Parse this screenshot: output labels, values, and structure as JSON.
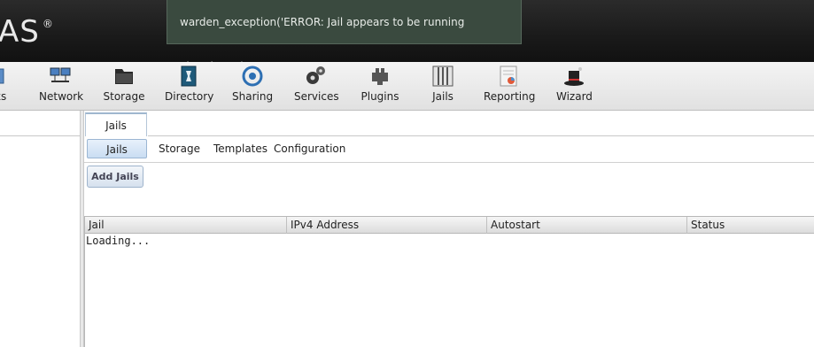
{
  "header": {
    "logo_text": "AS",
    "logo_mark": "®",
    "toast_message": "warden_exception('ERROR: Jail appears to be running already!\\n',)"
  },
  "toolbar": {
    "items": [
      {
        "label": "ks",
        "icon": "account-icon"
      },
      {
        "label": "Network",
        "icon": "network-icon"
      },
      {
        "label": "Storage",
        "icon": "storage-icon"
      },
      {
        "label": "Directory",
        "icon": "directory-icon"
      },
      {
        "label": "Sharing",
        "icon": "sharing-icon"
      },
      {
        "label": "Services",
        "icon": "services-icon"
      },
      {
        "label": "Plugins",
        "icon": "plugins-icon"
      },
      {
        "label": "Jails",
        "icon": "jails-icon"
      },
      {
        "label": "Reporting",
        "icon": "reporting-icon"
      },
      {
        "label": "Wizard",
        "icon": "wizard-icon"
      }
    ]
  },
  "main": {
    "tab_label": "Jails",
    "subtabs": [
      "Jails",
      "Storage",
      "Templates",
      "Configuration"
    ],
    "add_button": "Add Jails",
    "grid": {
      "columns": [
        "Jail",
        "IPv4 Address",
        "Autostart",
        "Status"
      ],
      "loading_text": "Loading..."
    }
  },
  "colors": {
    "header_bg": "#1a1a1a",
    "toast_bg": "#3a4a3f",
    "active_tab_bg": "#c9ddf2"
  }
}
